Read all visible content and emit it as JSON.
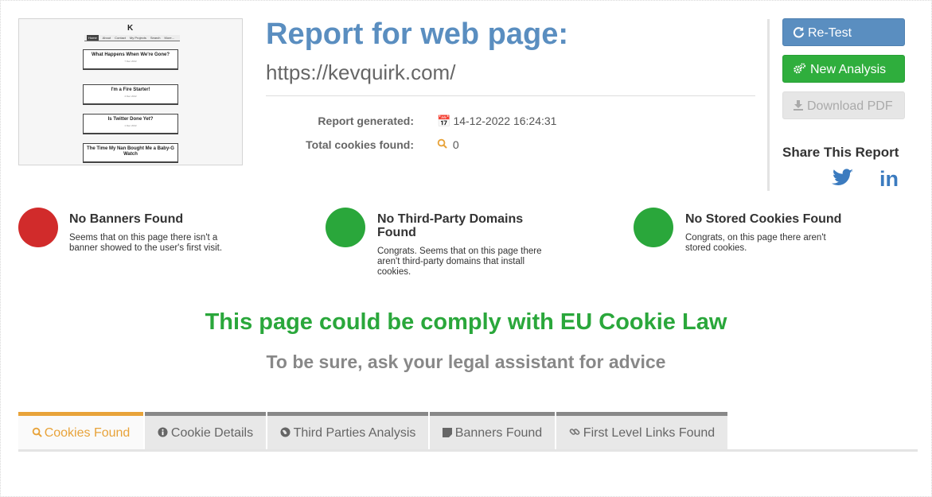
{
  "thumbnail": {
    "logo": "K",
    "nav": [
      "Home",
      "About",
      "Contact",
      "My Projects",
      "Search",
      "More..."
    ],
    "cards": [
      {
        "title": "What Happens When We're Gone?",
        "date": "7 Dec 2022"
      },
      {
        "title": "I'm a Fire Starter!",
        "date": "4 Dec 2022"
      },
      {
        "title": "Is Twitter Done Yet?",
        "date": "1 Dec 2022"
      },
      {
        "title": "The Time My Nan Bought Me a Baby-G Watch",
        "date": ""
      }
    ]
  },
  "header": {
    "title": "Report for web page:",
    "url": "https://kevquirk.com/"
  },
  "meta": {
    "generated_label": "Report generated:",
    "generated_value": "14-12-2022 16:24:31",
    "cookies_label": "Total cookies found:",
    "cookies_value": "0",
    "calendar_icon": "calendar-icon",
    "search_icon": "search-icon"
  },
  "actions": {
    "retest": "Re-Test",
    "new_analysis": "New Analysis",
    "download_pdf": "Download PDF"
  },
  "share": {
    "title": "Share This Report",
    "twitter_icon": "twitter-icon",
    "linkedin_icon": "linkedin-icon",
    "linkedin_glyph": "in"
  },
  "statuses": [
    {
      "title": "No Banners Found",
      "desc": "Seems that on this page there isn't a banner showed to the user's first visit.",
      "color": "#d12b2b"
    },
    {
      "title": "No Third-Party Domains Found",
      "desc": "Congrats. Seems that on this page there aren't third-party domains that install cookies.",
      "color": "#2aa73b"
    },
    {
      "title": "No Stored Cookies Found",
      "desc": "Congrats, on this page there aren't stored cookies.",
      "color": "#2aa73b"
    }
  ],
  "verdict": {
    "text": "This page could be comply with EU Cookie Law",
    "advice": "To be sure, ask your legal assistant for advice"
  },
  "tabs": [
    {
      "label": "Cookies Found",
      "icon": "search-icon",
      "active": true
    },
    {
      "label": "Cookie Details",
      "icon": "info-icon",
      "active": false
    },
    {
      "label": "Third Parties Analysis",
      "icon": "globe-icon",
      "active": false
    },
    {
      "label": "Banners Found",
      "icon": "banner-icon",
      "active": false
    },
    {
      "label": "First Level Links Found",
      "icon": "link-icon",
      "active": false
    }
  ],
  "colors": {
    "accent_blue": "#5a8ec0",
    "success_green": "#2aa73b",
    "error_red": "#d12b2b",
    "tab_active": "#e8a33a"
  }
}
